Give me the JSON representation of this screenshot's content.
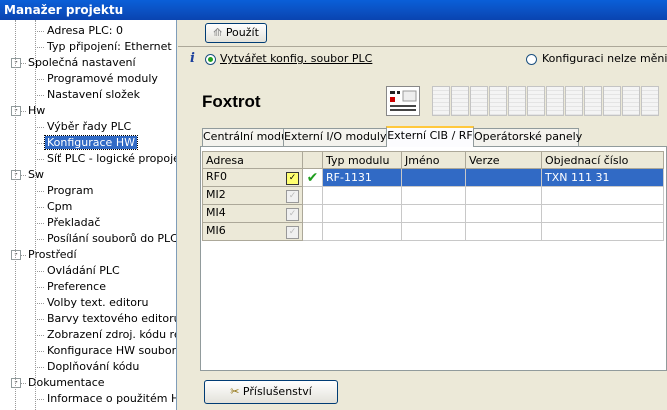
{
  "window": {
    "title": "Manažer projektu"
  },
  "tree": [
    {
      "label": "Adresa PLC: 0",
      "level": 1,
      "exp": ""
    },
    {
      "label": "Typ připojení: Ethernet",
      "level": 1,
      "exp": ""
    },
    {
      "label": "Společná nastavení",
      "level": 0,
      "exp": "-"
    },
    {
      "label": "Programové moduly",
      "level": 1,
      "exp": ""
    },
    {
      "label": "Nastavení složek",
      "level": 1,
      "exp": ""
    },
    {
      "label": "Hw",
      "level": 0,
      "exp": "-"
    },
    {
      "label": "Výběr řady PLC",
      "level": 1,
      "exp": ""
    },
    {
      "label": "Konfigurace HW",
      "level": 1,
      "exp": "",
      "selected": true
    },
    {
      "label": "Síť PLC - logické propojení",
      "level": 1,
      "exp": ""
    },
    {
      "label": "Sw",
      "level": 0,
      "exp": "-"
    },
    {
      "label": "Program",
      "level": 1,
      "exp": ""
    },
    {
      "label": "Cpm",
      "level": 1,
      "exp": ""
    },
    {
      "label": "Překladač",
      "level": 1,
      "exp": ""
    },
    {
      "label": "Posílání souborů do PLC",
      "level": 1,
      "exp": ""
    },
    {
      "label": "Prostředí",
      "level": 0,
      "exp": "-"
    },
    {
      "label": "Ovládání PLC",
      "level": 1,
      "exp": ""
    },
    {
      "label": "Preference",
      "level": 1,
      "exp": ""
    },
    {
      "label": "Volby text. editoru",
      "level": 1,
      "exp": ""
    },
    {
      "label": "Barvy textového editoru",
      "level": 1,
      "exp": ""
    },
    {
      "label": "Zobrazení zdroj. kódu releo",
      "level": 1,
      "exp": ""
    },
    {
      "label": "Konfigurace HW souborů",
      "level": 1,
      "exp": ""
    },
    {
      "label": "Doplňování kódu",
      "level": 1,
      "exp": ""
    },
    {
      "label": "Dokumentace",
      "level": 0,
      "exp": "-"
    },
    {
      "label": "Informace o použitém HW",
      "level": 1,
      "exp": ""
    }
  ],
  "toolbar": {
    "apply_label": "Použít"
  },
  "options": {
    "create_label": "Vytvářet konfig. soubor PLC",
    "cannot_change_label": "Konfiguraci nelze měnit"
  },
  "device": {
    "name": "Foxtrot"
  },
  "tabs": [
    "Centrální modul",
    "Externí I/O moduly",
    "Externí CIB / RF",
    "Operátorské panely"
  ],
  "active_tab": 2,
  "table": {
    "headers": [
      "Adresa",
      "",
      "Typ modulu",
      "Jméno",
      "Verze",
      "Objednací číslo"
    ],
    "rows": [
      {
        "addr": "RF0",
        "checked": true,
        "type": "RF-1131",
        "name": "",
        "ver": "",
        "order": "TXN 111 31"
      },
      {
        "addr": "MI2",
        "checked": false,
        "type": "",
        "name": "",
        "ver": "",
        "order": ""
      },
      {
        "addr": "MI4",
        "checked": false,
        "type": "",
        "name": "",
        "ver": "",
        "order": ""
      },
      {
        "addr": "MI6",
        "checked": false,
        "type": "",
        "name": "",
        "ver": "",
        "order": ""
      }
    ]
  },
  "accessories": {
    "label": "Příslušenství"
  }
}
